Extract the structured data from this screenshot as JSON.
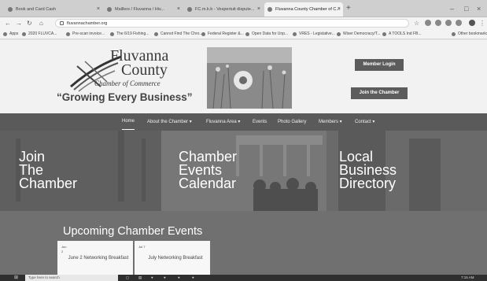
{
  "browser": {
    "tabs": [
      {
        "label": "Book and Card Cash"
      },
      {
        "label": "Mailbox / Fluvanna / Hiv..."
      },
      {
        "label": "FC.m.k.b - Vespertuit dispute..."
      },
      {
        "label": "Fluvanna County Chamber of C..."
      }
    ],
    "new_tab": "+",
    "window_controls": [
      "–",
      "□",
      "×"
    ],
    "address": "fluvannachamber.org",
    "bookmarks": [
      "Apps",
      "2020 FLUVCA...",
      "Pre-scan invoice...",
      "The 6/19 Fishing...",
      "Cannot Find The Chro...",
      "Federal Register &...",
      "Open Data for Unp...",
      "VRES - Legislative...",
      "Wiser Democracy/T...",
      "A TOOLS Ind FB...",
      "Other bookmarks"
    ]
  },
  "header": {
    "logo": {
      "line1": "Fluvanna",
      "line2": "County",
      "line3": "Chamber of Commerce",
      "tagline": "“Growing Every Business”"
    },
    "member_login": "Member Login",
    "join_button": "Join the Chamber"
  },
  "nav": {
    "items": [
      {
        "label": "Home"
      },
      {
        "label": "About the Chamber ▾"
      },
      {
        "label": "Fluvanna Area ▾"
      },
      {
        "label": "Events"
      },
      {
        "label": "Photo Gallery"
      },
      {
        "label": "Members ▾"
      },
      {
        "label": "Contact ▾"
      }
    ]
  },
  "hero": {
    "panels": [
      {
        "text": "Join\nThe\nChamber"
      },
      {
        "text": "Chamber\nEvents\nCalendar"
      },
      {
        "text": "Local\nBusiness\nDirectory"
      }
    ]
  },
  "events": {
    "title": "Upcoming Chamber Events",
    "cards": [
      {
        "date": "Jun\n2",
        "title": "June 2 Networking Breakfast"
      },
      {
        "date": "Jul 7",
        "title": "July Networking Breakfast"
      }
    ]
  },
  "taskbar": {
    "search": "Type here to search",
    "clock": "7:15 AM"
  }
}
